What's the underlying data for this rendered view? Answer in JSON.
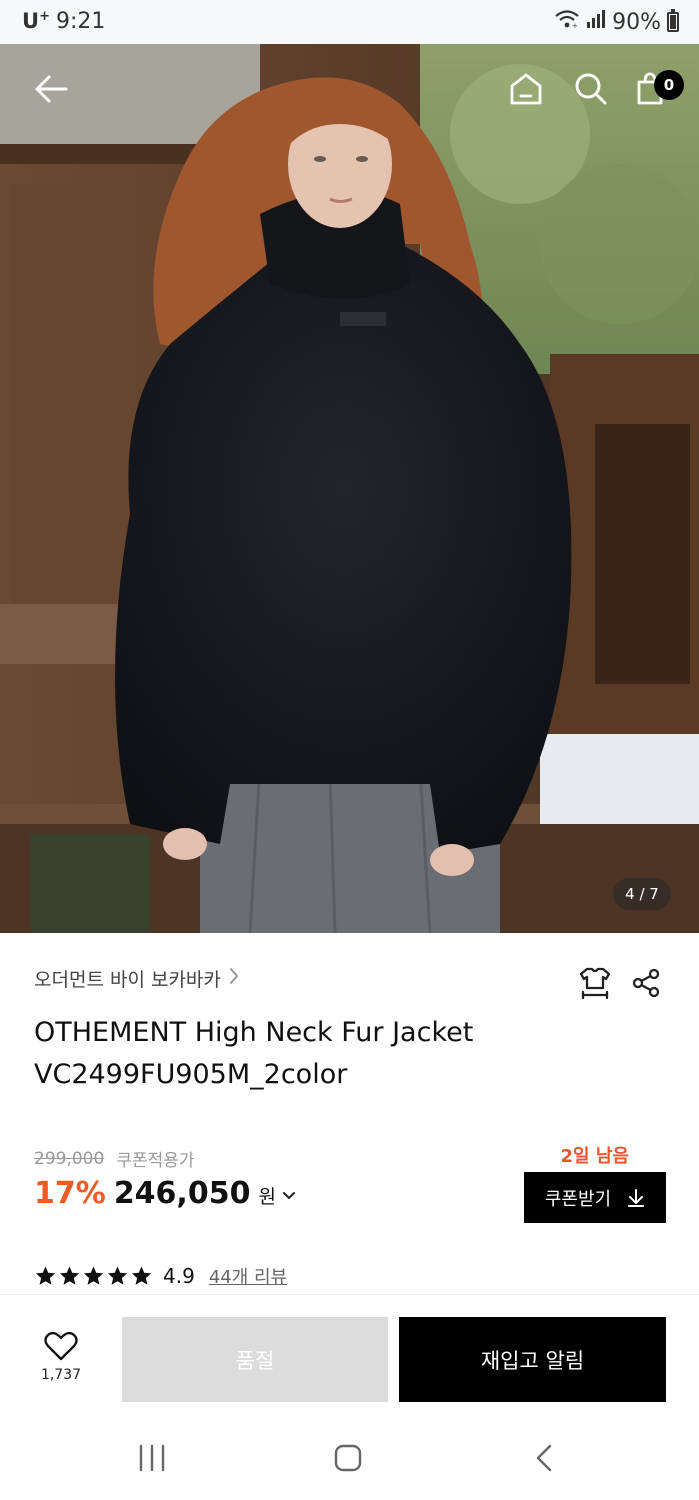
{
  "status_bar": {
    "carrier": "U",
    "carrier_sup": "+",
    "time": "9:21",
    "battery": "90%",
    "icons": [
      "wifi-icon",
      "signal-icon",
      "battery-icon"
    ]
  },
  "header": {
    "icons": [
      "back-arrow-icon",
      "home-icon",
      "search-icon",
      "shopping-bag-icon"
    ],
    "cart_count": "0"
  },
  "gallery": {
    "page_indicator": "4 / 7",
    "current": 4,
    "total": 7
  },
  "product": {
    "brand": "오더먼트 바이 보카바카",
    "title_line1": "OTHEMENT High Neck Fur Jacket",
    "title_line2": "VC2499FU905M_2color",
    "original_price": "299,000",
    "coupon_note": "쿠폰적용가",
    "discount": "17%",
    "price": "246,050",
    "currency": "원",
    "days_left": "2일 남음",
    "coupon_button": "쿠폰받기",
    "rating": "4.9",
    "stars": 5,
    "reviews": "44개 리뷰",
    "icons": [
      "size-guide-icon",
      "share-icon",
      "download-icon",
      "star-icon"
    ]
  },
  "actions": {
    "like_count": "1,737",
    "soldout_label": "품절",
    "restock_label": "재입고 알림"
  },
  "nav": {
    "icons": [
      "recent-apps-icon",
      "home-nav-icon",
      "back-nav-icon"
    ]
  },
  "colors": {
    "accent": "#f05a24",
    "days_left": "#e4572e",
    "primary": "#000000",
    "disabled": "#dcdcdc"
  }
}
